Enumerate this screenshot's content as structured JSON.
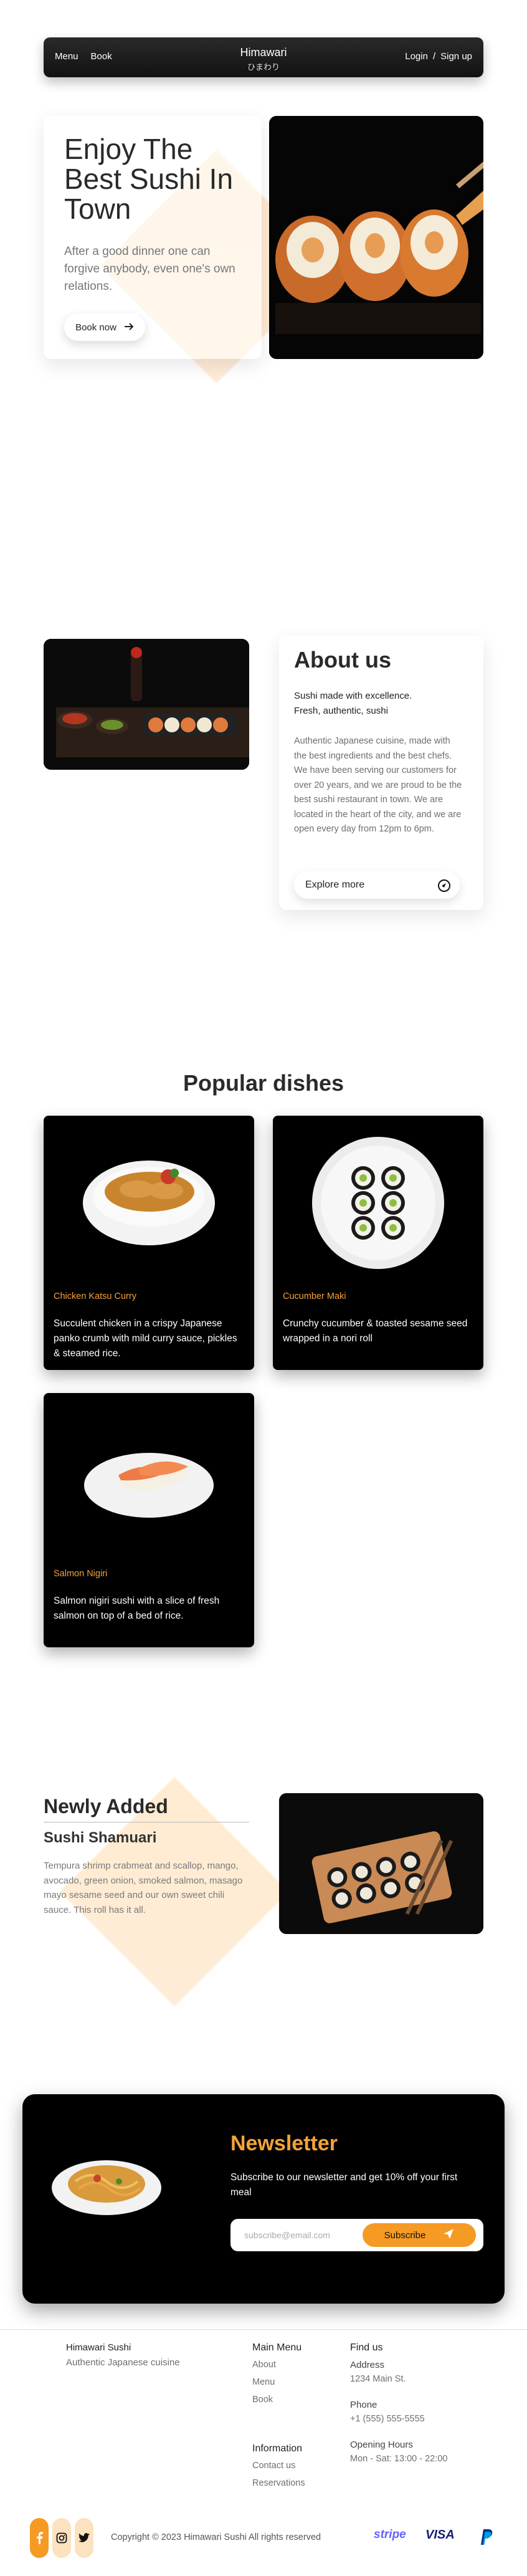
{
  "nav": {
    "menu": "Menu",
    "book": "Book",
    "brand": "Himawari",
    "brand_sub": "ひまわり",
    "login": "Login",
    "separator": "/",
    "signup": "Sign up"
  },
  "hero": {
    "title": "Enjoy The Best Sushi In Town",
    "subtitle": "After a good dinner one can forgive anybody, even one's own relations.",
    "cta": "Book now"
  },
  "about": {
    "title": "About us",
    "tagline1": "Sushi made with excellence.",
    "tagline2": "Fresh, authentic, sushi",
    "body": "Authentic Japanese cuisine, made with the best ingredients and the best chefs. We have been serving our customers for over 20 years, and we are proud to be the best sushi restaurant in town. We are located in the heart of the city, and we are open every day from 12pm to 6pm.",
    "cta": "Explore more"
  },
  "popular": {
    "title": "Popular dishes",
    "dishes": [
      {
        "name": "Chicken Katsu Curry",
        "desc": "Succulent chicken in a crispy Japanese panko crumb with mild curry sauce, pickles & steamed rice."
      },
      {
        "name": "Cucumber Maki",
        "desc": "Crunchy cucumber & toasted sesame seed wrapped in a nori roll"
      },
      {
        "name": "Salmon Nigiri",
        "desc": "Salmon nigiri sushi with a slice of fresh salmon on top of a bed of rice."
      }
    ]
  },
  "new_added": {
    "title": "Newly Added",
    "name": "Sushi Shamuari",
    "desc": "Tempura shrimp crabmeat and scallop, mango, avocado, green onion, smoked salmon, masago mayo sesame seed and our own sweet chili sauce. This roll has it all."
  },
  "newsletter": {
    "title": "Newsletter",
    "text": "Subscribe to our newsletter and get 10% off your first meal",
    "placeholder": "subscribe@email.com",
    "cta": "Subscribe"
  },
  "footer": {
    "brand": "Himawari Sushi",
    "brand_sub": "Authentic Japanese cuisine",
    "main_menu": {
      "title": "Main Menu",
      "links": [
        "About",
        "Menu",
        "Book"
      ]
    },
    "information": {
      "title": "Information",
      "links": [
        "Contact us",
        "Reservations"
      ]
    },
    "find_us": {
      "title": "Find us",
      "address_label": "Address",
      "address": "1234 Main St.",
      "phone_label": "Phone",
      "phone": "+1 (555) 555-5555",
      "hours_label": "Opening Hours",
      "hours": "Mon - Sat: 13:00 - 22:00"
    },
    "copyright": "Copyright © 2023 Himawari Sushi All rights reserved",
    "social": [
      "facebook-icon",
      "instagram-icon",
      "twitter-icon"
    ],
    "payments": {
      "stripe": "stripe",
      "visa": "VISA",
      "paypal": "paypal-icon"
    }
  },
  "colors": {
    "accent": "#f59a23",
    "accent_text": "#f4a23a",
    "dark": "#000000"
  }
}
